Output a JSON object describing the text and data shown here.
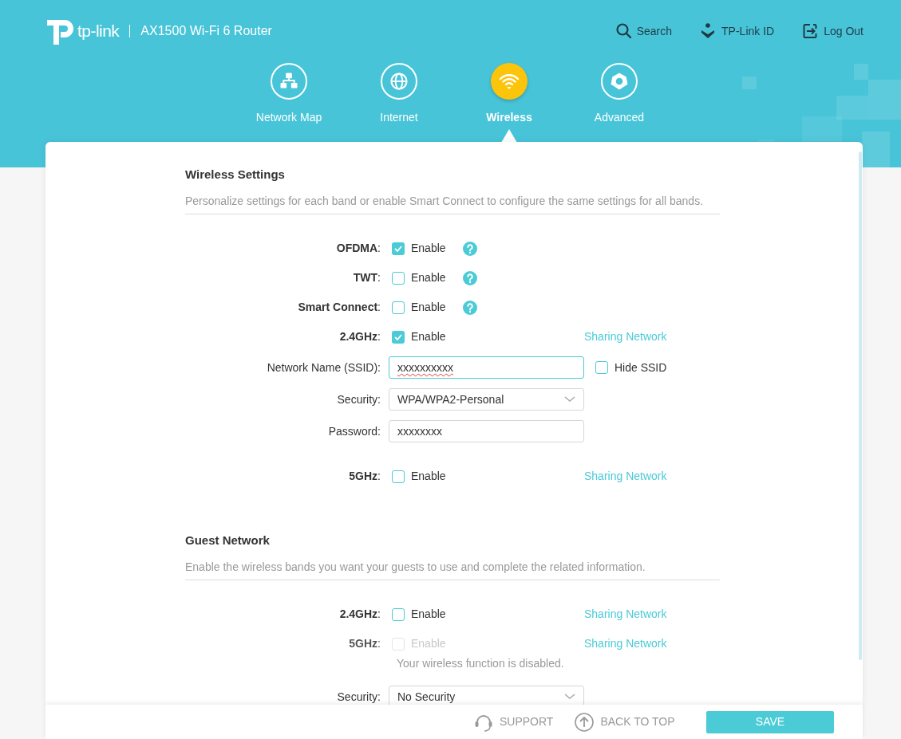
{
  "header": {
    "brand": "tp-link",
    "product": "AX1500 Wi-Fi 6 Router",
    "actions": [
      {
        "kind": "search",
        "label": "Search"
      },
      {
        "kind": "id",
        "label": "TP-Link ID"
      },
      {
        "kind": "logout",
        "label": "Log Out"
      }
    ]
  },
  "nav": [
    {
      "kind": "network",
      "label": "Network Map",
      "selected": false
    },
    {
      "kind": "internet",
      "label": "Internet",
      "selected": false
    },
    {
      "kind": "wireless",
      "label": "Wireless",
      "selected": true
    },
    {
      "kind": "advanced",
      "label": "Advanced",
      "selected": false
    }
  ],
  "sections": [
    {
      "title": "Wireless Settings",
      "description": "Personalize settings for each band or enable Smart Connect to configure the same settings for all bands.",
      "rows": [
        {
          "kind": "checkbox",
          "label": "**OFDMA**:",
          "option": "Enable",
          "checked": true,
          "disabled": false,
          "help": true
        },
        {
          "kind": "checkbox",
          "label": "**TWT**:",
          "option": "Enable",
          "checked": false,
          "disabled": false,
          "help": true
        },
        {
          "kind": "checkbox",
          "label": "**Smart Connect**:",
          "option": "Enable",
          "checked": false,
          "disabled": false,
          "help": true
        },
        {
          "kind": "checkbox",
          "label": "**2.4GHz**:",
          "option": "Enable",
          "checked": true,
          "disabled": false,
          "help": false,
          "link": "Sharing Network"
        },
        {
          "kind": "field",
          "label": "Network Name (SSID):",
          "value": "xxxxxxxxxx",
          "focused": true,
          "misspelled": true,
          "side_checkbox": {
            "label": "Hide SSID",
            "checked": false
          }
        },
        {
          "kind": "select",
          "label": "Security:",
          "value": "WPA/WPA2-Personal"
        },
        {
          "kind": "field",
          "label": "Password:",
          "value": "xxxxxxxx",
          "focused": false,
          "misspelled": false
        },
        {
          "kind": "checkbox",
          "label": "**5GHz**:",
          "option": "Enable",
          "checked": false,
          "disabled": false,
          "help": false,
          "link": "Sharing Network"
        }
      ]
    },
    {
      "title": "Guest Network",
      "description": "Enable the wireless bands you want your guests to use and complete the related information.",
      "rows": [
        {
          "kind": "checkbox",
          "label": "**2.4GHz**:",
          "option": "Enable",
          "checked": false,
          "disabled": false,
          "help": false,
          "link": "Sharing Network"
        },
        {
          "kind": "checkbox",
          "label": "**5GHz**:",
          "option": "Enable",
          "checked": false,
          "disabled": true,
          "help": false,
          "link": "Sharing Network"
        },
        {
          "kind": "note",
          "text": "Your wireless function is disabled."
        },
        {
          "kind": "select",
          "label": "Security:",
          "value": "No Security"
        }
      ]
    }
  ],
  "footer": {
    "support": "SUPPORT",
    "back_to_top": "BACK TO TOP",
    "save": "SAVE"
  }
}
